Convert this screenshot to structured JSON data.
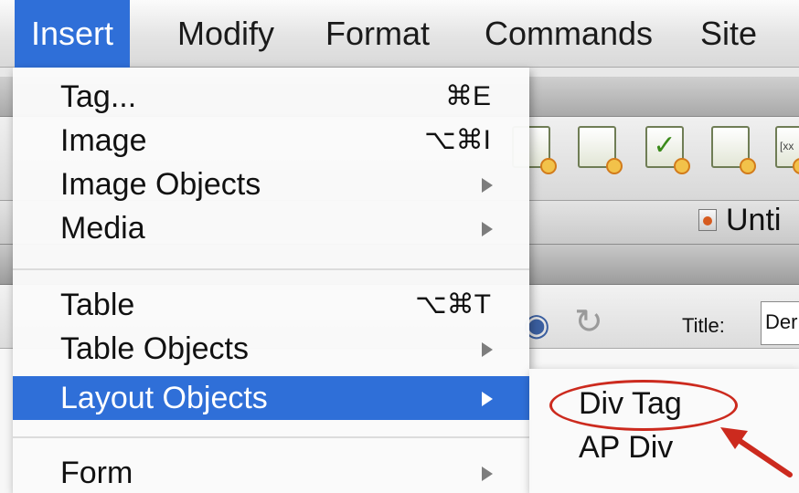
{
  "menubar": {
    "items": [
      {
        "label": "Insert",
        "active": true
      },
      {
        "label": "Modify",
        "active": false
      },
      {
        "label": "Format",
        "active": false
      },
      {
        "label": "Commands",
        "active": false
      },
      {
        "label": "Site",
        "active": false
      }
    ]
  },
  "insert_menu": {
    "items": [
      {
        "label": "Tag...",
        "shortcut": "⌘E",
        "submenu": false
      },
      {
        "label": "Image",
        "shortcut": "⌥⌘I",
        "submenu": false
      },
      {
        "label": "Image Objects",
        "shortcut": "",
        "submenu": true
      },
      {
        "label": "Media",
        "shortcut": "",
        "submenu": true
      },
      {
        "label": "Table",
        "shortcut": "⌥⌘T",
        "submenu": false
      },
      {
        "label": "Table Objects",
        "shortcut": "",
        "submenu": true
      },
      {
        "label": "Layout Objects",
        "shortcut": "",
        "submenu": true,
        "highlighted": true
      },
      {
        "label": "Form",
        "shortcut": "",
        "submenu": true
      }
    ]
  },
  "layout_submenu": {
    "items": [
      {
        "label": "Div Tag",
        "circled": true
      },
      {
        "label": "AP Div"
      }
    ]
  },
  "background": {
    "document_tab": "Unti",
    "title_label": "Title:",
    "title_value": "Der"
  },
  "colors": {
    "highlight": "#2f6fd8",
    "annotation": "#cc2a1e"
  }
}
